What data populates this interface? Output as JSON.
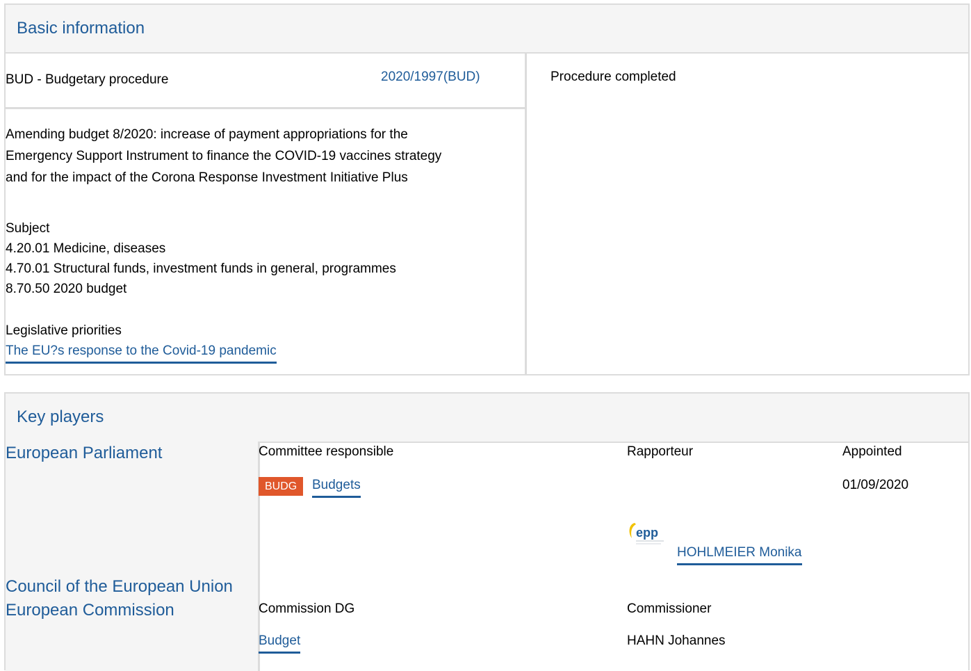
{
  "basic_info": {
    "title": "Basic information",
    "procedure_type": "BUD - Budgetary procedure",
    "procedure_ref": "2020/1997(BUD)",
    "status": "Procedure completed",
    "description_lines": [
      "Amending budget 8/2020: increase of payment appropriations for the",
      "Emergency Support Instrument to finance the COVID-19 vaccines strategy",
      "and for the impact of the Corona Response Investment Initiative Plus"
    ],
    "subject_label": "Subject",
    "subjects": [
      "4.20.01 Medicine, diseases",
      "4.70.01 Structural funds, investment funds in general, programmes",
      "8.70.50 2020 budget"
    ],
    "priorities_label": "Legislative priorities",
    "priority_link": "The EU?s response to the Covid-19 pandemic"
  },
  "key_players": {
    "title": "Key players",
    "ep": {
      "name": "European Parliament",
      "committee_header": "Committee responsible",
      "rapporteur_header": "Rapporteur",
      "appointed_header": "Appointed",
      "committee_code": "BUDG",
      "committee_name": "Budgets",
      "appointed_date": "01/09/2020",
      "party_logo_text": "epp",
      "rapporteur_name": "HOHLMEIER Monika"
    },
    "council": {
      "name": "Council of the European Union"
    },
    "commission": {
      "name": "European Commission",
      "dg_header": "Commission DG",
      "commissioner_header": "Commissioner",
      "dg_name": "Budget",
      "commissioner_name": "HAHN Johannes"
    }
  },
  "colors": {
    "link": "#1f5c99",
    "badge": "#e0572b",
    "header_bg": "#f5f5f5",
    "border": "#dcdcdc"
  }
}
